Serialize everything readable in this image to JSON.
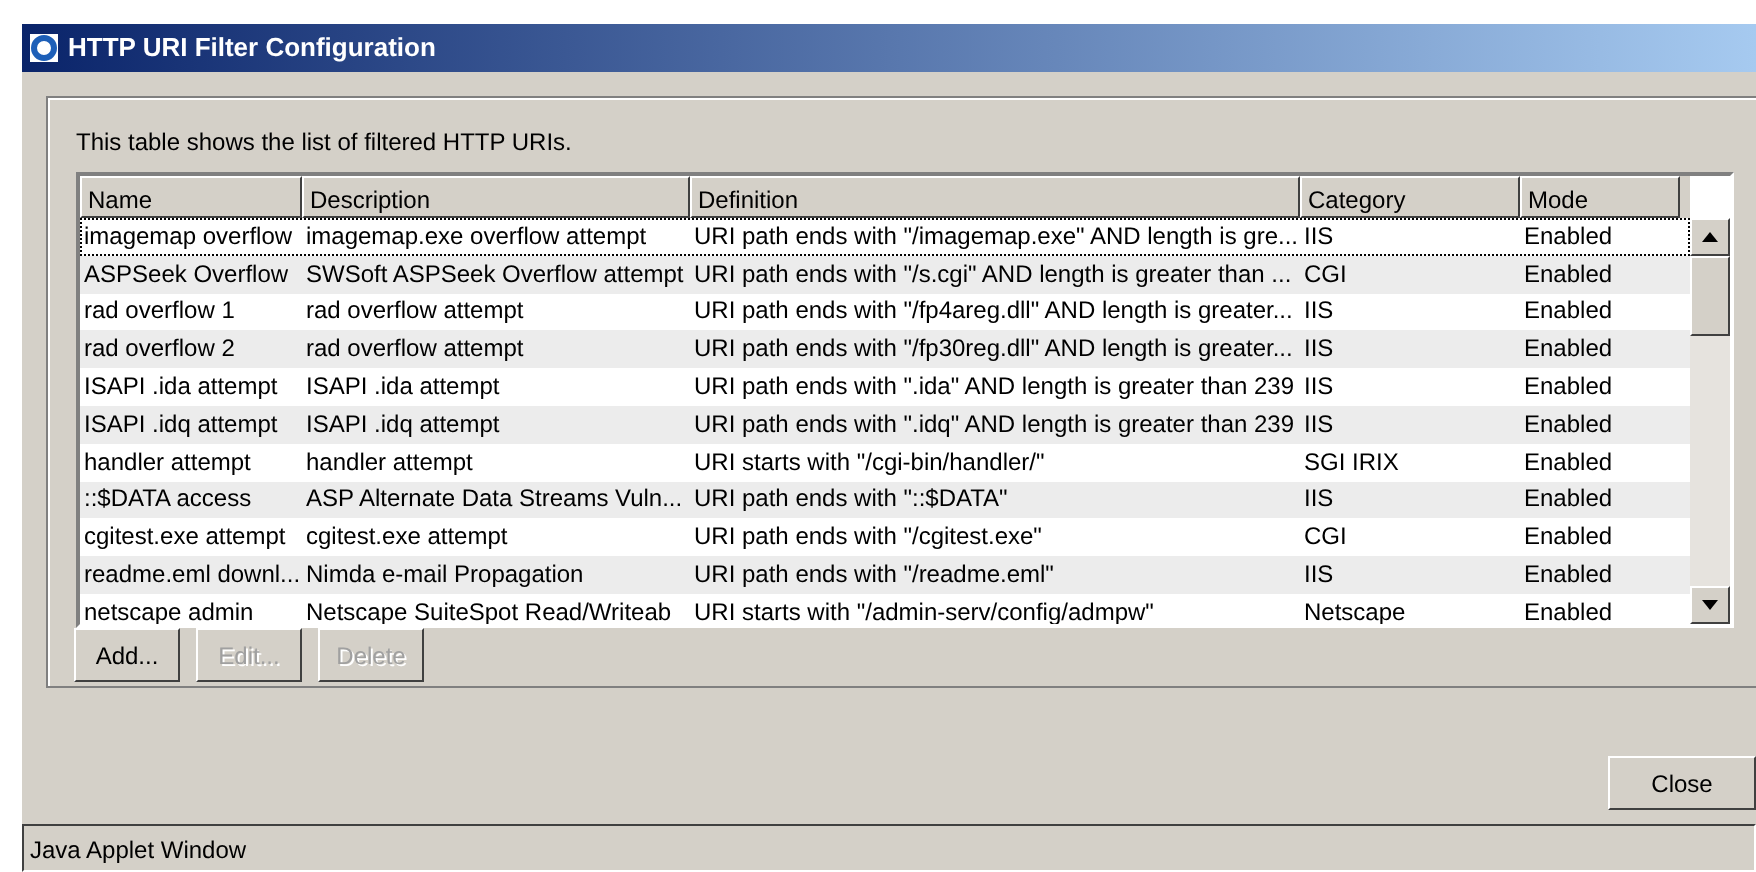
{
  "window": {
    "title": "HTTP URI Filter Configuration"
  },
  "intro": "This table shows the list of filtered HTTP URIs.",
  "table": {
    "columns": [
      "Name",
      "Description",
      "Definition",
      "Category",
      "Mode"
    ],
    "rows": [
      {
        "cells": [
          "imagemap overflow",
          "imagemap.exe overflow attempt",
          "URI path ends with \"/imagemap.exe\" AND length is gre...",
          "IIS",
          "Enabled"
        ],
        "focused": true
      },
      {
        "cells": [
          "ASPSeek Overflow",
          "SWSoft ASPSeek Overflow attempt",
          "URI path ends with \"/s.cgi\" AND length is greater than ...",
          "CGI",
          "Enabled"
        ],
        "focused": false
      },
      {
        "cells": [
          "rad overflow 1",
          "rad overflow attempt",
          "URI path ends with \"/fp4areg.dll\" AND length is greater...",
          "IIS",
          "Enabled"
        ],
        "focused": false
      },
      {
        "cells": [
          "rad overflow 2",
          "rad overflow attempt",
          "URI path ends with \"/fp30reg.dll\" AND length is greater...",
          "IIS",
          "Enabled"
        ],
        "focused": false
      },
      {
        "cells": [
          "ISAPI .ida attempt",
          "ISAPI .ida attempt",
          "URI path ends with \".ida\" AND length is greater than 239",
          "IIS",
          "Enabled"
        ],
        "focused": false
      },
      {
        "cells": [
          "ISAPI .idq attempt",
          "ISAPI .idq attempt",
          "URI path ends with \".idq\" AND length is greater than 239",
          "IIS",
          "Enabled"
        ],
        "focused": false
      },
      {
        "cells": [
          "handler attempt",
          "handler attempt",
          "URI starts with \"/cgi-bin/handler/\"",
          "SGI IRIX",
          "Enabled"
        ],
        "focused": false
      },
      {
        "cells": [
          "::$DATA access",
          "ASP Alternate Data Streams Vuln...",
          "URI path ends with \"::$DATA\"",
          "IIS",
          "Enabled"
        ],
        "focused": false
      },
      {
        "cells": [
          "cgitest.exe attempt",
          "cgitest.exe attempt",
          "URI path ends with \"/cgitest.exe\"",
          "CGI",
          "Enabled"
        ],
        "focused": false
      },
      {
        "cells": [
          "readme.eml downl...",
          "Nimda e-mail Propagation",
          "URI path ends with \"/readme.eml\"",
          "IIS",
          "Enabled"
        ],
        "focused": false
      },
      {
        "cells": [
          "netscape admin",
          "Netscape SuiteSpot Read/Writeab",
          "URI starts with \"/admin-serv/config/admpw\"",
          "Netscape",
          "Enabled"
        ],
        "focused": false
      }
    ]
  },
  "table_buttons": [
    {
      "label": "Add...",
      "disabled": false
    },
    {
      "label": "Edit...",
      "disabled": true
    },
    {
      "label": "Delete",
      "disabled": true
    }
  ],
  "close_button": "Close",
  "status_bar": "Java Applet Window"
}
